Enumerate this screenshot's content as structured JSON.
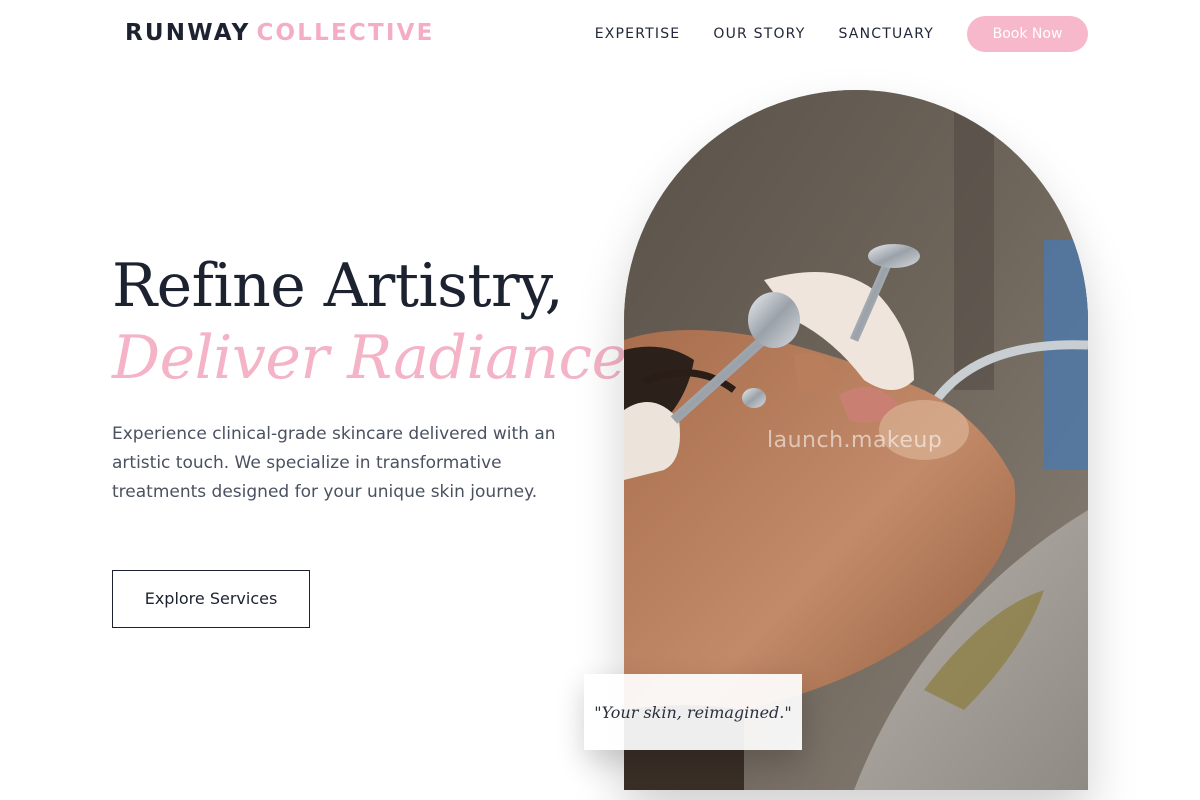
{
  "brand": {
    "part1": "RUNWAY",
    "part2": "COLLECTIVE"
  },
  "nav": {
    "items": [
      "EXPERTISE",
      "OUR STORY",
      "SANCTUARY"
    ],
    "cta_label": "Book Now"
  },
  "hero": {
    "headline_line1": "Refine Artistry,",
    "headline_line2": "Deliver Radiance.",
    "intro": "Experience clinical-grade skincare delivered with an artistic touch. We specialize in transformative treatments designed for your unique skin journey.",
    "cta_label": "Explore Services"
  },
  "image": {
    "watermark": "launch.makeup",
    "quote": "\"Your skin, reimagined.\""
  },
  "colors": {
    "accent_pink": "#f4b3c6",
    "button_pink": "#f7b8cb",
    "ink": "#1c2230",
    "body_text": "#4a5160"
  }
}
